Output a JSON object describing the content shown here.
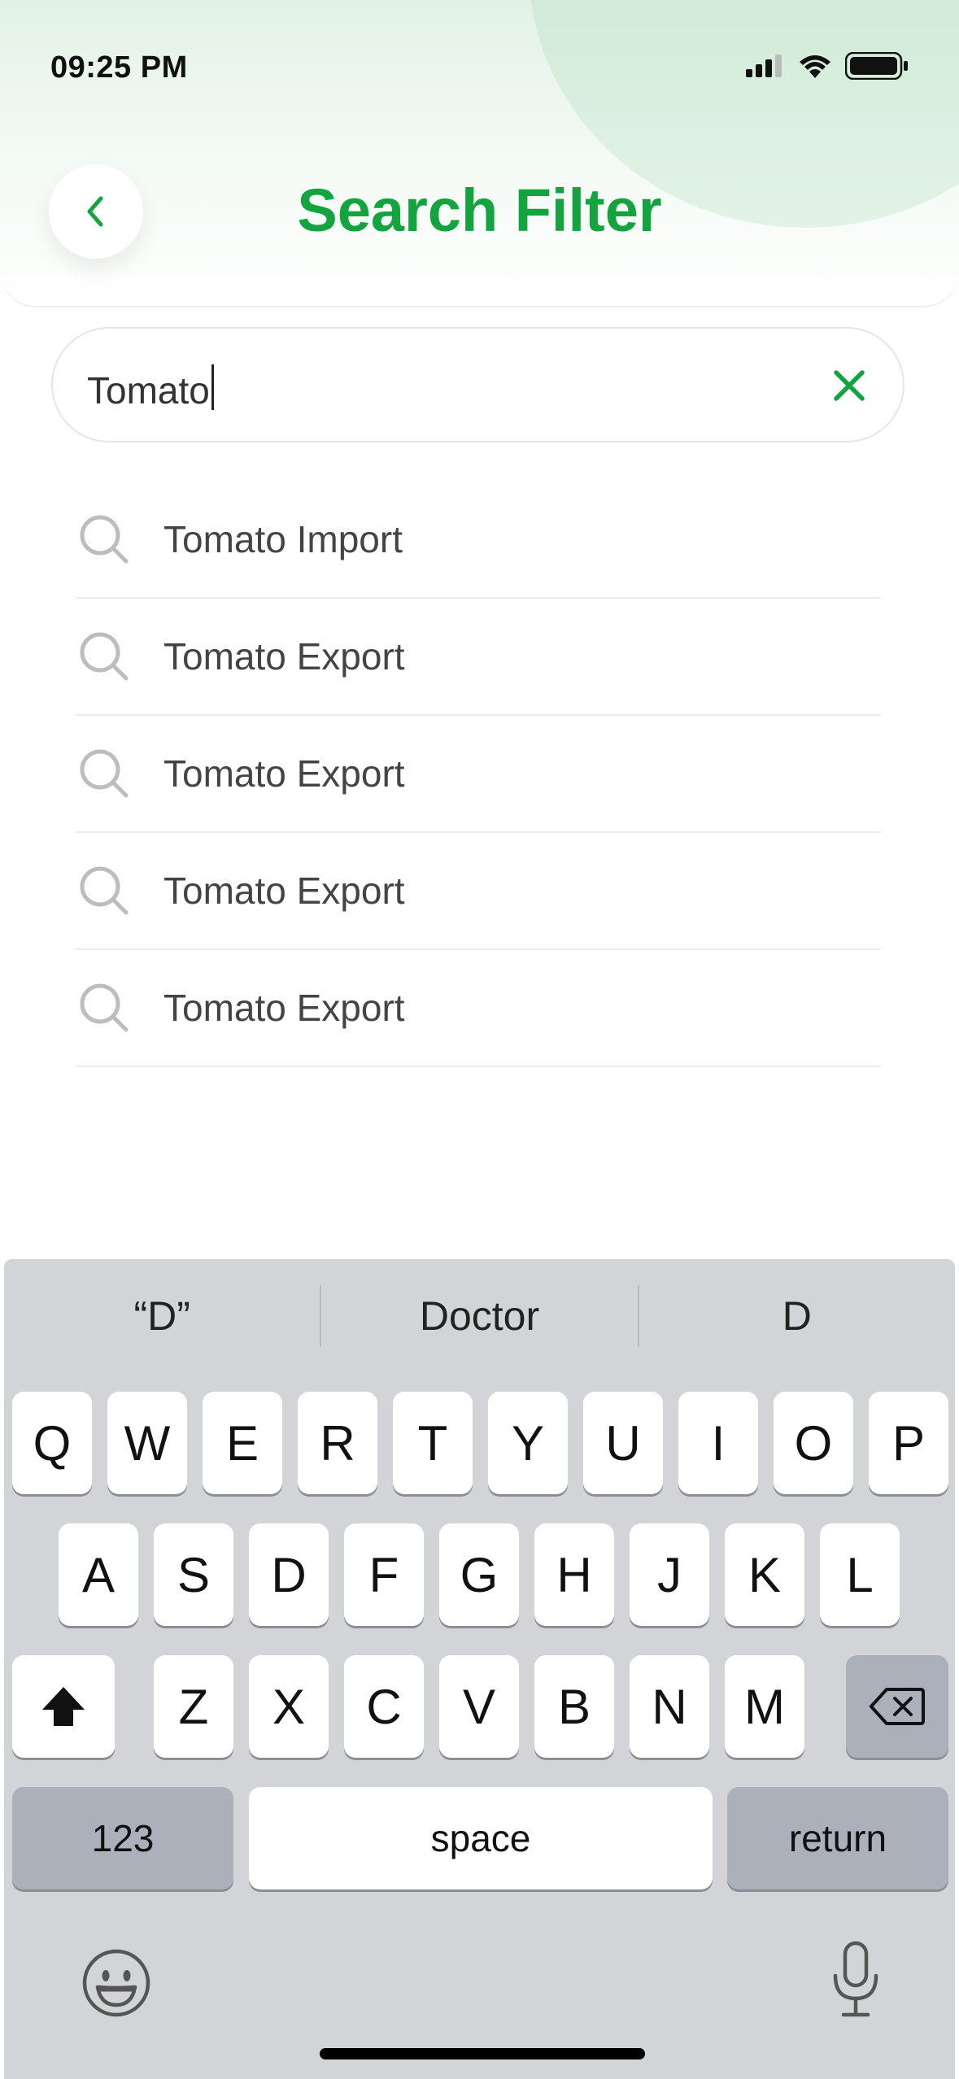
{
  "status_bar": {
    "time": "09:25 PM"
  },
  "header": {
    "title": "Search Filter"
  },
  "search": {
    "value": "Tomato"
  },
  "suggestions": [
    {
      "label": "Tomato Import"
    },
    {
      "label": "Tomato Export"
    },
    {
      "label": "Tomato Export"
    },
    {
      "label": "Tomato Export"
    },
    {
      "label": "Tomato Export"
    }
  ],
  "keyboard": {
    "predictions": [
      "“D”",
      "Doctor",
      "D"
    ],
    "row1": [
      "Q",
      "W",
      "E",
      "R",
      "T",
      "Y",
      "U",
      "I",
      "O",
      "P"
    ],
    "row2": [
      "A",
      "S",
      "D",
      "F",
      "G",
      "H",
      "J",
      "K",
      "L"
    ],
    "row3": [
      "Z",
      "X",
      "C",
      "V",
      "B",
      "N",
      "M"
    ],
    "numbers_label": "123",
    "space_label": "space",
    "return_label": "return"
  },
  "colors": {
    "accent": "#13a33f",
    "keyboard_bg": "#d3d4d8",
    "dark_key": "#abb0bb"
  },
  "icons": {
    "back": "chevron-left-icon",
    "clear": "close-icon",
    "suggestion": "search-icon",
    "shift": "shift-icon",
    "delete": "backspace-icon",
    "emoji": "emoji-icon",
    "mic": "microphone-icon"
  }
}
